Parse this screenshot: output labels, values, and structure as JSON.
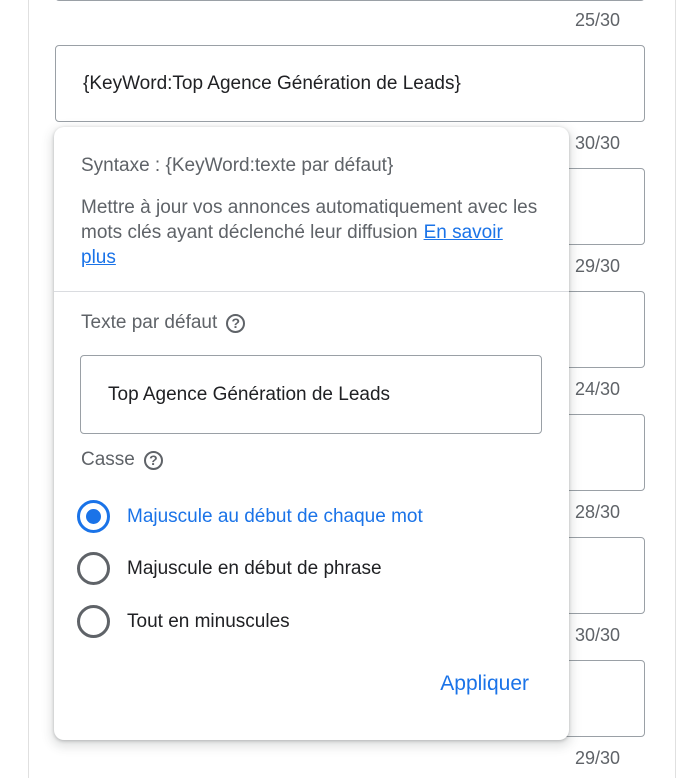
{
  "background_fields": [
    {
      "value": "{KeyWord:Top Agence Génération de Leads}",
      "counter": "25/30"
    },
    {
      "value": "",
      "counter": "30/30"
    },
    {
      "value": "",
      "counter": "29/30"
    },
    {
      "value": "",
      "counter": "24/30"
    },
    {
      "value": "",
      "counter": "28/30"
    },
    {
      "value": "",
      "counter": "30/30"
    },
    {
      "value": "",
      "counter": "29/30"
    }
  ],
  "popup": {
    "syntax": "Syntaxe : {KeyWord:texte par défaut}",
    "description": "Mettre à jour vos annonces automatiquement avec les mots clés ayant déclenché leur diffusion",
    "learn_more": "En savoir plus",
    "default_text_label": "Texte par défaut",
    "default_text_value": "Top Agence Génération de Leads",
    "case_label": "Casse",
    "case_options": [
      {
        "label": "Majuscule au début de chaque mot",
        "selected": true
      },
      {
        "label": "Majuscule en début de phrase",
        "selected": false
      },
      {
        "label": "Tout en minuscules",
        "selected": false
      }
    ],
    "apply_label": "Appliquer",
    "help_icon": "help-circle-icon"
  },
  "colors": {
    "accent": "#1a73e8",
    "text": "#202124",
    "secondary_text": "#5f6368",
    "border": "#9aa0a6"
  }
}
